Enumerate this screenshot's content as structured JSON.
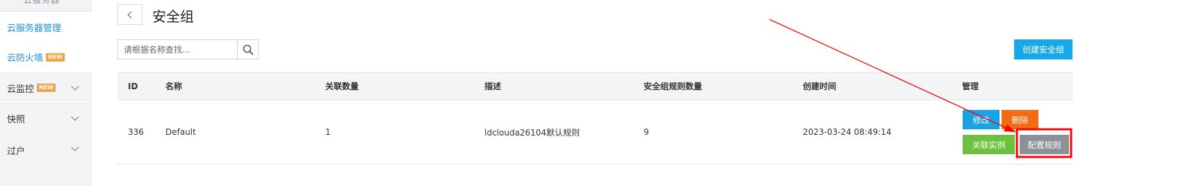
{
  "sidebar": {
    "header_label": "云服务器",
    "items": [
      {
        "label": "云服务器管理"
      },
      {
        "label": "云防火墙",
        "badge": "NEW"
      },
      {
        "label": "云监控",
        "badge": "NEW"
      },
      {
        "label": "快照"
      },
      {
        "label": "过户"
      }
    ]
  },
  "header": {
    "back_icon": "chevron-left-icon",
    "title": "安全组"
  },
  "search": {
    "placeholder": "请根据名称查找...",
    "icon": "search-icon"
  },
  "toolbar": {
    "create_label": "创建安全组"
  },
  "table": {
    "columns": [
      "ID",
      "名称",
      "关联数量",
      "描述",
      "安全组规则数量",
      "创建时间",
      "管理"
    ],
    "rows": [
      {
        "id": "336",
        "name": "Default",
        "count": "1",
        "desc": "ldclouda26104默认规则",
        "rules": "9",
        "created": "2023-03-24 08:49:14",
        "actions": {
          "edit": "修改",
          "delete": "删除",
          "link": "关联实例",
          "config": "配置规则"
        }
      }
    ]
  },
  "colors": {
    "accent": "#18a7ea",
    "edit": "#1aa2e6",
    "delete": "#f36b13",
    "link": "#6cc23e",
    "config": "#8d9096",
    "annotation": "#ff0000"
  }
}
